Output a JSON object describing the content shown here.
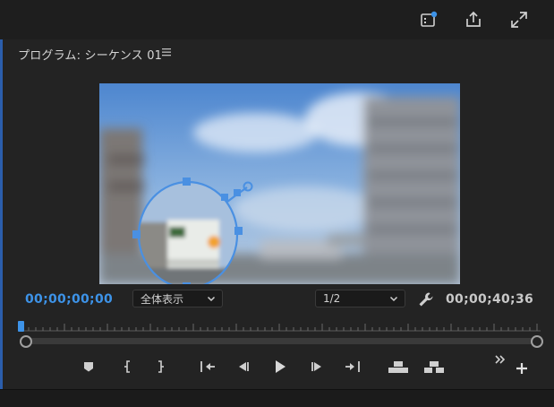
{
  "panel": {
    "title": "プログラム: シーケンス 01",
    "menu_icon": "hamburger-icon"
  },
  "toolbar_top": {
    "icons": [
      "sequence-settings-icon",
      "export-icon",
      "fullscreen-icon"
    ],
    "notification_color": "#3d93e8"
  },
  "monitor": {
    "timecode_current": "00;00;00;00",
    "timecode_duration": "00;00;40;36",
    "zoom_dropdown": {
      "value": "全体表示"
    },
    "resolution_dropdown": {
      "value": "1/2"
    }
  },
  "colors": {
    "accent": "#3d93e8",
    "panel_bg": "#232323",
    "mask_outline": "#4a90e2"
  },
  "controls": {
    "icons": [
      "add-marker-icon",
      "mark-in-icon",
      "mark-out-icon",
      "go-to-in-icon",
      "step-back-icon",
      "play-icon",
      "step-forward-icon",
      "go-to-out-icon",
      "lift-icon",
      "extract-icon",
      "more-controls-icon",
      "button-editor-plus-icon"
    ]
  }
}
